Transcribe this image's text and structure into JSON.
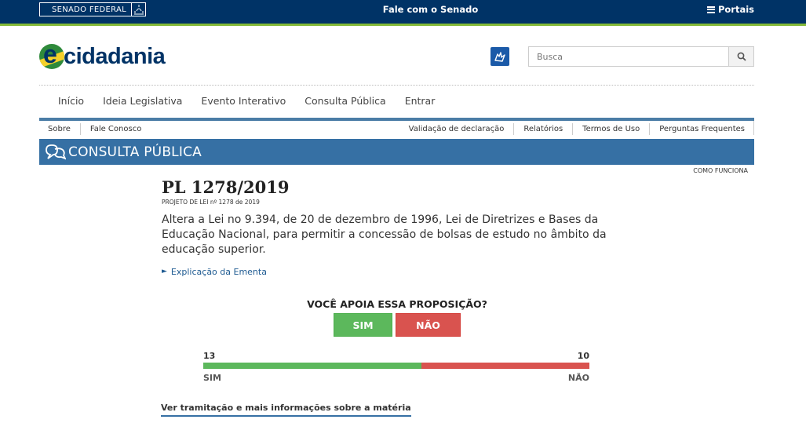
{
  "topbar": {
    "senado_label": "SENADO FEDERAL",
    "fale_label": "Fale com o Senado",
    "portais_label": "Portais"
  },
  "logo": {
    "e": "e",
    "wordmark": "cidadania"
  },
  "search": {
    "placeholder": "Busca"
  },
  "mainnav": {
    "items": [
      "Início",
      "Ideia Legislativa",
      "Evento Interativo",
      "Consulta Pública",
      "Entrar"
    ]
  },
  "subnav": {
    "left": [
      "Sobre",
      "Fale Conosco"
    ],
    "right": [
      "Validação de declaração",
      "Relatórios",
      "Termos de Uso",
      "Perguntas Frequentes"
    ]
  },
  "banner": {
    "title": "CONSULTA PÚBLICA",
    "como_funciona": "COMO FUNCIONA"
  },
  "proposicao": {
    "title": "PL 1278/2019",
    "subtitle": "PROJETO DE LEI nº 1278 de 2019",
    "ementa": "Altera a Lei no 9.394, de 20 de dezembro de 1996, Lei de Diretrizes e Bases da Educação Nacional, para permitir a concessão de bolsas de estudo no âmbito da educação superior.",
    "explicacao": "Explicação da Ementa"
  },
  "votacao": {
    "question": "VOCÊ APOIA ESSA PROPOSIÇÃO?",
    "sim_label": "SIM",
    "nao_label": "NÃO",
    "sim_count": "13",
    "nao_count": "10",
    "sim_fraction": 0.565,
    "bar_sim_label": "SIM",
    "bar_nao_label": "NÃO",
    "colors": {
      "sim": "#5cb85c",
      "nao": "#d9534f"
    }
  },
  "footer_link": "Ver tramitação e mais informações sobre a matéria"
}
